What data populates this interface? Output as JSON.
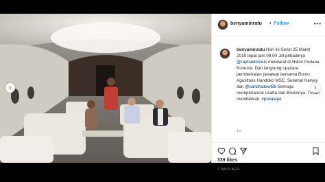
{
  "post": {
    "username": "benyaminratu",
    "separator": "•",
    "follow_label": "Follow",
    "more_label": "•••",
    "caption_user": "benyaminratu",
    "caption": {
      "p1": "Hari ini Senin 25 Maret 2019 tepat jam 09.00 Jet pribadinya",
      "mention1": "@raphaelmoeis",
      "p2": "mendarat di Halim Pedana Kusuma. Dan langsung upacara pemberkatan pesawat bersama Romo Agustinus Handoko MSC. Selamat Harvey dan",
      "mention2": "@sandradewi88",
      "p3": "Semoga memperlancar usaha dan Bisnisnya. Tuhan memberkati.",
      "hashtag": "#privatejet"
    },
    "reply_label": "1w",
    "likes": "339 likes",
    "time_ago": "7 DAYS AGO"
  },
  "carousel": {
    "prev_icon": "‹",
    "next_icon": "›"
  },
  "colors": {
    "link": "#003569",
    "follow": "#3897f0",
    "background": "#000000"
  }
}
